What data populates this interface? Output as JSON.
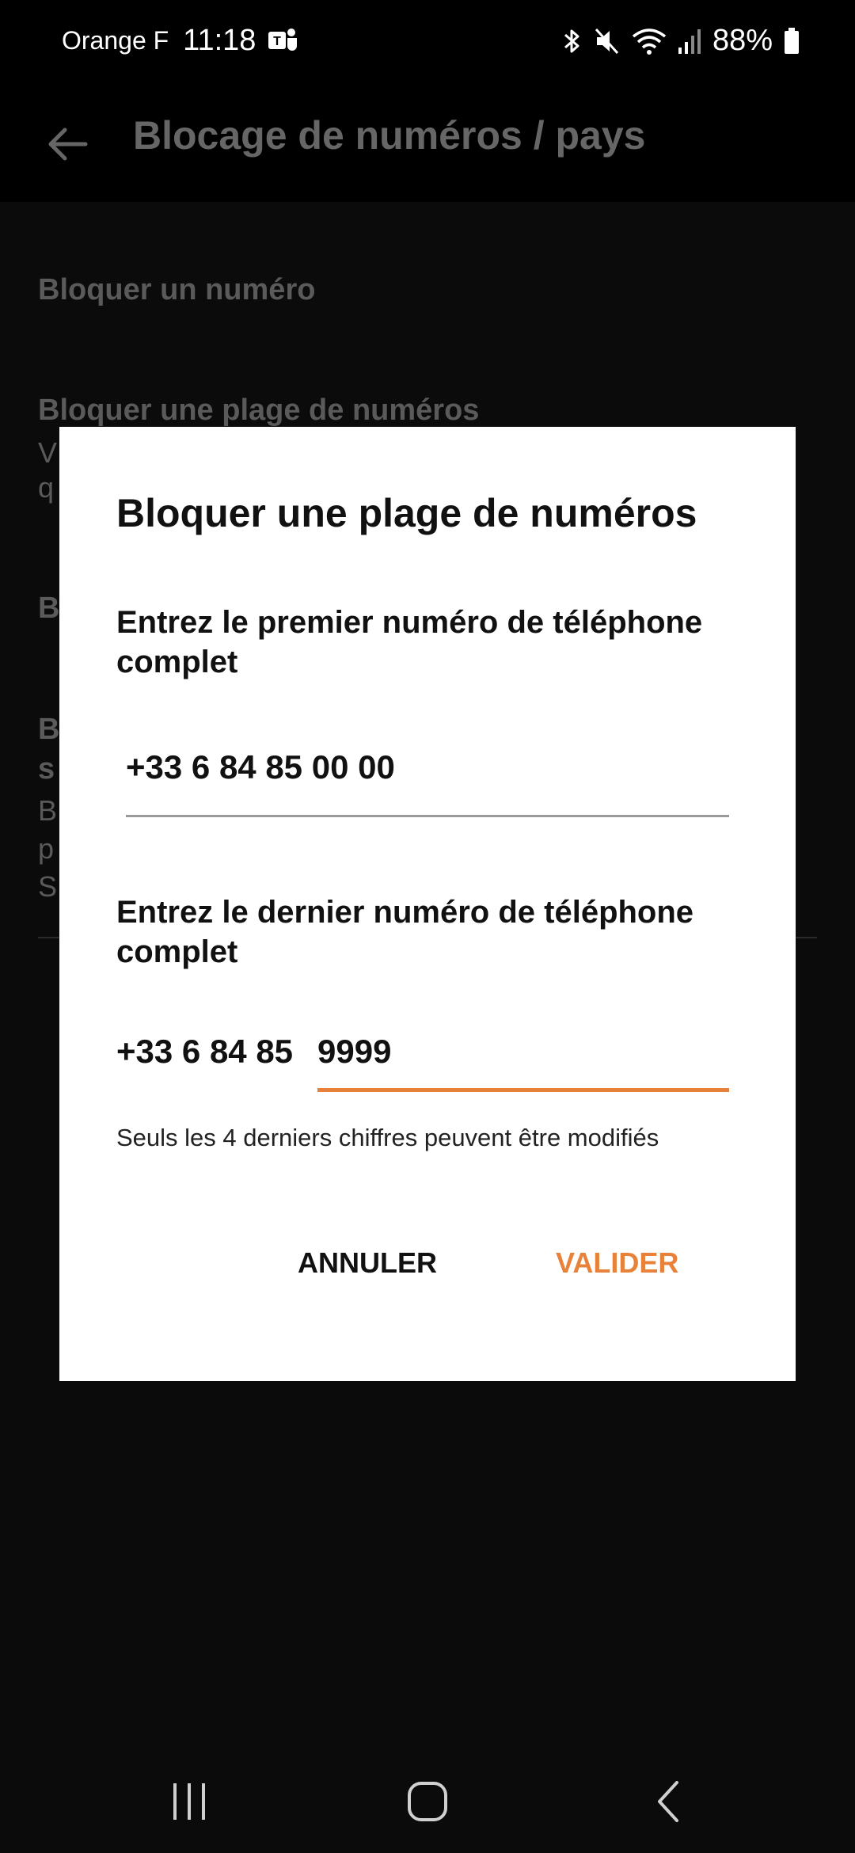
{
  "status_bar": {
    "carrier": "Orange F",
    "time": "11:18",
    "battery": "88%",
    "icons": [
      "teams-icon",
      "bluetooth-icon",
      "mute-icon",
      "wifi-icon",
      "signal-icon",
      "battery-icon"
    ]
  },
  "app_bar": {
    "title": "Blocage de numéros / pays"
  },
  "background_list": {
    "item1_title": "Bloquer un numéro",
    "item2_title": "Bloquer une plage de numéros",
    "item2_sub1": "V",
    "item2_sub2": "q",
    "item3_title": "B",
    "item4_title1": "B",
    "item4_title2": "s",
    "item4_sub1": "B",
    "item4_sub2": "p",
    "item4_sub3": "S"
  },
  "dialog": {
    "title": "Bloquer une plage de numéros",
    "first_label": "Entrez le premier numéro de téléphone complet",
    "first_value": "+33 6 84 85 00 00",
    "last_label": "Entrez le dernier numéro de téléphone complet",
    "last_prefix": "+33 6 84 85",
    "last_value": "9999",
    "hint": "Seuls les 4 derniers chiffres peuvent être modifiés",
    "cancel_label": "ANNULER",
    "ok_label": "VALIDER"
  },
  "colors": {
    "accent": "#e8823a",
    "dialog_bg": "#ffffff",
    "screen_bg": "#0b0b0b"
  }
}
